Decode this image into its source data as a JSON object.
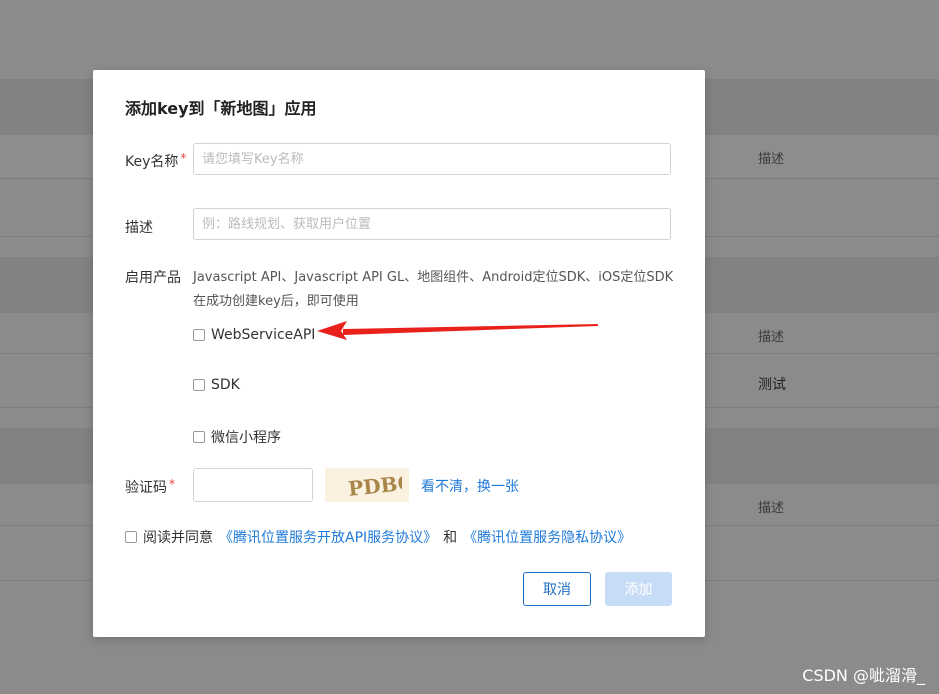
{
  "background": {
    "col_labels": [
      "描述",
      "描述",
      "描述"
    ],
    "row_value": "测试"
  },
  "dialog": {
    "title": "添加key到「新地图」应用",
    "key_name": {
      "label": "Key名称",
      "required_mark": "*",
      "placeholder": "请您填写Key名称",
      "value": ""
    },
    "description": {
      "label": "描述",
      "placeholder": "例：路线规划、获取用户位置",
      "value": ""
    },
    "products": {
      "label": "启用产品",
      "desc": "Javascript API、Javascript API GL、地图组件、Android定位SDK、iOS定位SDK在成功创建key后，即可使用",
      "options": [
        {
          "label": "WebServiceAPI",
          "checked": false
        },
        {
          "label": "SDK",
          "checked": false
        },
        {
          "label": "微信小程序",
          "checked": false
        }
      ]
    },
    "captcha": {
      "label": "验证码",
      "required_mark": "*",
      "value": "",
      "image_text": "PDBO",
      "refresh_text": "看不清，换一张"
    },
    "agreement": {
      "prefix": "阅读并同意",
      "link1": "《腾讯位置服务开放API服务协议》",
      "middle": "和",
      "link2": "《腾讯位置服务隐私协议》",
      "checked": false
    },
    "buttons": {
      "cancel": "取消",
      "add": "添加"
    }
  },
  "colors": {
    "accent": "#1f7ad8",
    "required": "#e54545",
    "disabled_button": "#c7dcf6",
    "arrow": "#e8221b"
  },
  "watermark": "CSDN @呲溜滑_"
}
